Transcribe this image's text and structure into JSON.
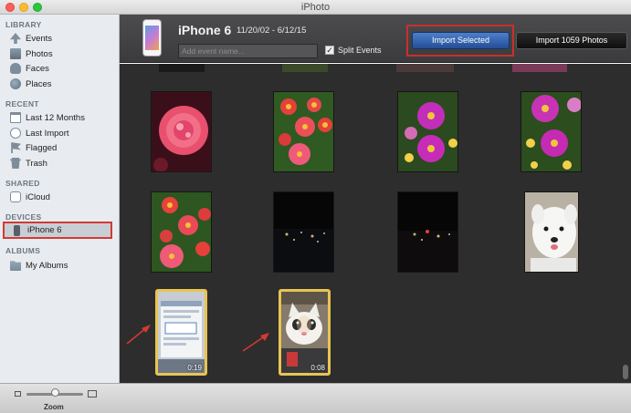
{
  "window": {
    "title": "iPhoto"
  },
  "sidebar": {
    "sections": [
      {
        "heading": "LIBRARY",
        "items": [
          {
            "label": "Events",
            "icon": "events-icon"
          },
          {
            "label": "Photos",
            "icon": "photos-icon"
          },
          {
            "label": "Faces",
            "icon": "faces-icon"
          },
          {
            "label": "Places",
            "icon": "places-icon"
          }
        ]
      },
      {
        "heading": "RECENT",
        "items": [
          {
            "label": "Last 12 Months",
            "icon": "calendar-icon"
          },
          {
            "label": "Last Import",
            "icon": "clock-icon"
          },
          {
            "label": "Flagged",
            "icon": "flag-icon"
          },
          {
            "label": "Trash",
            "icon": "trash-icon"
          }
        ]
      },
      {
        "heading": "SHARED",
        "items": [
          {
            "label": "iCloud",
            "icon": "icloud-icon"
          }
        ]
      },
      {
        "heading": "DEVICES",
        "items": [
          {
            "label": "iPhone 6",
            "icon": "iphone-icon",
            "selected": true
          }
        ]
      },
      {
        "heading": "ALBUMS",
        "items": [
          {
            "label": "My Albums",
            "icon": "folder-icon"
          }
        ]
      }
    ]
  },
  "header": {
    "device_name": "iPhone 6",
    "date_range": "11/20/02 - 6/12/15",
    "event_name_placeholder": "Add event name...",
    "split_events_label": "Split Events",
    "split_events_checked": true,
    "import_selected_label": "Import Selected",
    "import_all_label": "Import 1059 Photos"
  },
  "grid": {
    "thumbnails": [
      {
        "kind": "pink-rose"
      },
      {
        "kind": "red-flowers"
      },
      {
        "kind": "purple-flowers"
      },
      {
        "kind": "purple-flowers"
      },
      {
        "kind": "red-flowers"
      },
      {
        "kind": "night-city"
      },
      {
        "kind": "night-city"
      },
      {
        "kind": "white-dog"
      },
      {
        "kind": "video-screenshot",
        "duration": "0:19",
        "selected": true
      },
      {
        "kind": "video-cat",
        "duration": "0:08",
        "selected": true
      }
    ]
  },
  "footer": {
    "zoom_label": "Zoom"
  },
  "colors": {
    "highlight_red": "#d33a32",
    "selection_yellow": "#e8c452",
    "import_blue": "#2f5ea8"
  }
}
